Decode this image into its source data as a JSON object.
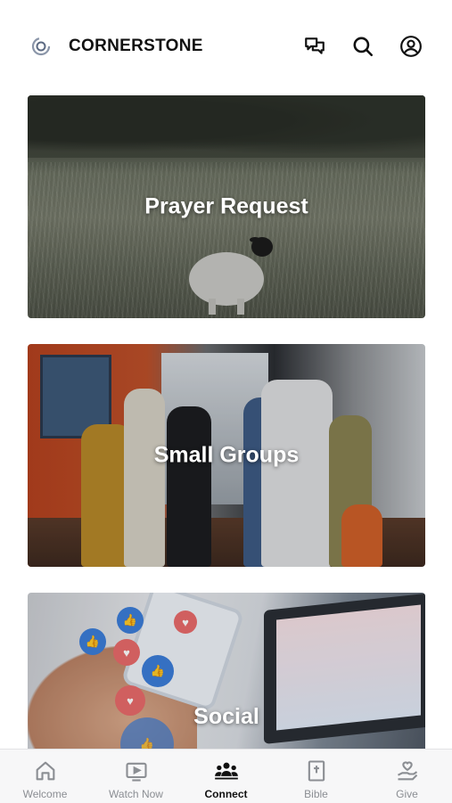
{
  "header": {
    "app_title": "CORNERSTONE",
    "logo_icon": "cornerstone-logo-icon",
    "icons": [
      "chat-icon",
      "search-icon",
      "account-icon"
    ]
  },
  "cards": [
    {
      "label": "Prayer Request"
    },
    {
      "label": "Small Groups"
    },
    {
      "label": "Social"
    }
  ],
  "tabbar": {
    "active": "Connect",
    "tabs": [
      {
        "label": "Welcome",
        "icon": "home-icon"
      },
      {
        "label": "Watch Now",
        "icon": "tv-play-icon"
      },
      {
        "label": "Connect",
        "icon": "people-icon"
      },
      {
        "label": "Bible",
        "icon": "bible-icon"
      },
      {
        "label": "Give",
        "icon": "give-heart-hand-icon"
      }
    ]
  },
  "colors": {
    "active_tab": "#111111",
    "inactive_tab": "#8b8e93",
    "social_like_blue": "#3b7dd8",
    "social_heart_red": "#e86a6a"
  }
}
